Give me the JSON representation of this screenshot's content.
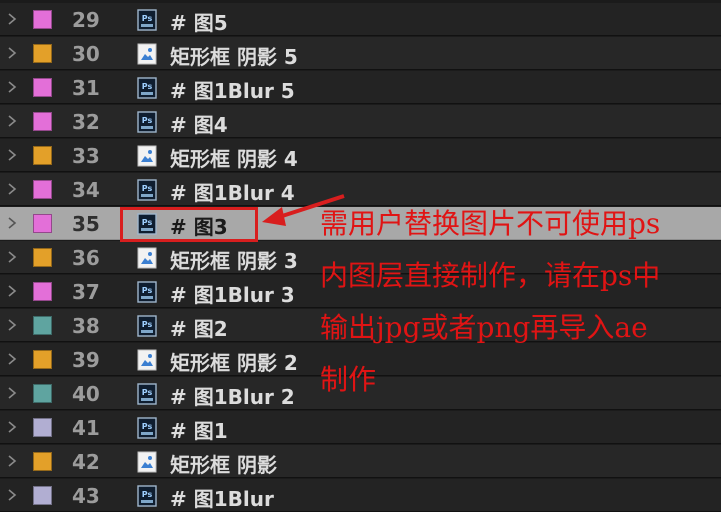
{
  "layers": [
    {
      "num": "29",
      "name": "# 图5",
      "color": "#e36fd8",
      "type": "ps"
    },
    {
      "num": "30",
      "name": "矩形框 阴影 5",
      "color": "#e3a029",
      "type": "image"
    },
    {
      "num": "31",
      "name": "# 图1Blur 5",
      "color": "#e36fd8",
      "type": "ps"
    },
    {
      "num": "32",
      "name": "# 图4",
      "color": "#e36fd8",
      "type": "ps"
    },
    {
      "num": "33",
      "name": "矩形框 阴影 4",
      "color": "#e3a029",
      "type": "image"
    },
    {
      "num": "34",
      "name": "# 图1Blur 4",
      "color": "#e36fd8",
      "type": "ps"
    },
    {
      "num": "35",
      "name": "# 图3",
      "color": "#e36fd8",
      "type": "ps",
      "selected": true
    },
    {
      "num": "36",
      "name": "矩形框 阴影 3",
      "color": "#e3a029",
      "type": "image"
    },
    {
      "num": "37",
      "name": "# 图1Blur 3",
      "color": "#e36fd8",
      "type": "ps"
    },
    {
      "num": "38",
      "name": "# 图2",
      "color": "#5fa4a0",
      "type": "ps"
    },
    {
      "num": "39",
      "name": "矩形框 阴影 2",
      "color": "#e3a029",
      "type": "image"
    },
    {
      "num": "40",
      "name": "# 图1Blur 2",
      "color": "#5fa4a0",
      "type": "ps"
    },
    {
      "num": "41",
      "name": "# 图1",
      "color": "#b1aed2",
      "type": "ps"
    },
    {
      "num": "42",
      "name": "矩形框 阴影",
      "color": "#e3a029",
      "type": "image"
    },
    {
      "num": "43",
      "name": "# 图1Blur",
      "color": "#b1aed2",
      "type": "ps"
    }
  ],
  "annotation": {
    "text": "需用户替换图片不可使用ps内图层直接制作，请在ps中输出jpg或者png再导入ae制作",
    "color": "#e01414"
  },
  "icons": {
    "ps": "photoshop-file-icon",
    "image": "image-file-icon",
    "expand": "chevron-right-icon"
  }
}
